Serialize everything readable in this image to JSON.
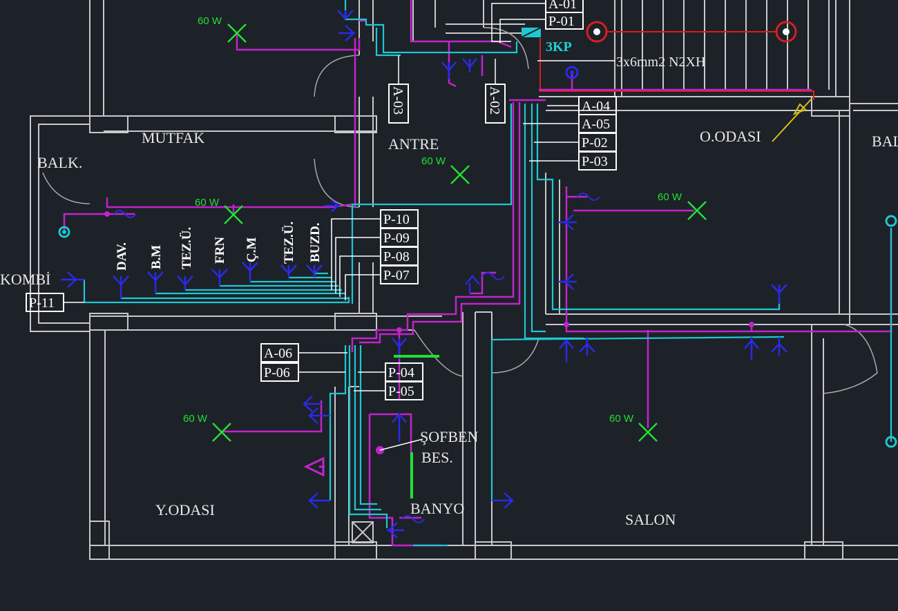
{
  "colors": {
    "background": "#1d2128",
    "wall": "#c9c9c9",
    "lighting_circuit": "#c224cc",
    "socket_circuit": "#1ec8d2",
    "socket_symbol": "#2a2ae8",
    "fixture": "#22e033",
    "label_box": "#ffffff",
    "main_line": "#d81e1e"
  },
  "rooms": {
    "mutfak": "MUTFAK",
    "balk": "BALK.",
    "antre": "ANTRE",
    "oodasi": "O.ODASI",
    "bal": "BAL",
    "kombi": "KOMBİ",
    "yodasi": "Y.ODASI",
    "banyo": "BANYO",
    "salon": "SALON"
  },
  "circuits": {
    "a01": "A-01",
    "p01": "P-01",
    "a02": "A-02",
    "a03": "A-03",
    "a04": "A-04",
    "a05": "A-05",
    "p02": "P-02",
    "p03": "P-03",
    "p10": "P-10",
    "p09": "P-09",
    "p08": "P-08",
    "p07": "P-07",
    "p11": "P-11",
    "a06": "A-06",
    "p06": "P-06",
    "p04": "P-04",
    "p05": "P-05"
  },
  "appliances": {
    "dav": "DAV.",
    "bm": "B.M",
    "tezu1": "TEZ.Ü.",
    "frn": "FRN",
    "cm": "Ç.M",
    "tezu2": "TEZ.Ü.",
    "buzd": "BUZD."
  },
  "panel": {
    "label": "3KP",
    "cable": "3x6mm2 N2XH"
  },
  "sofben": {
    "line1": "ŞOFBEN",
    "line2": "BES."
  },
  "fixtures": {
    "watt_label": "60 W"
  }
}
